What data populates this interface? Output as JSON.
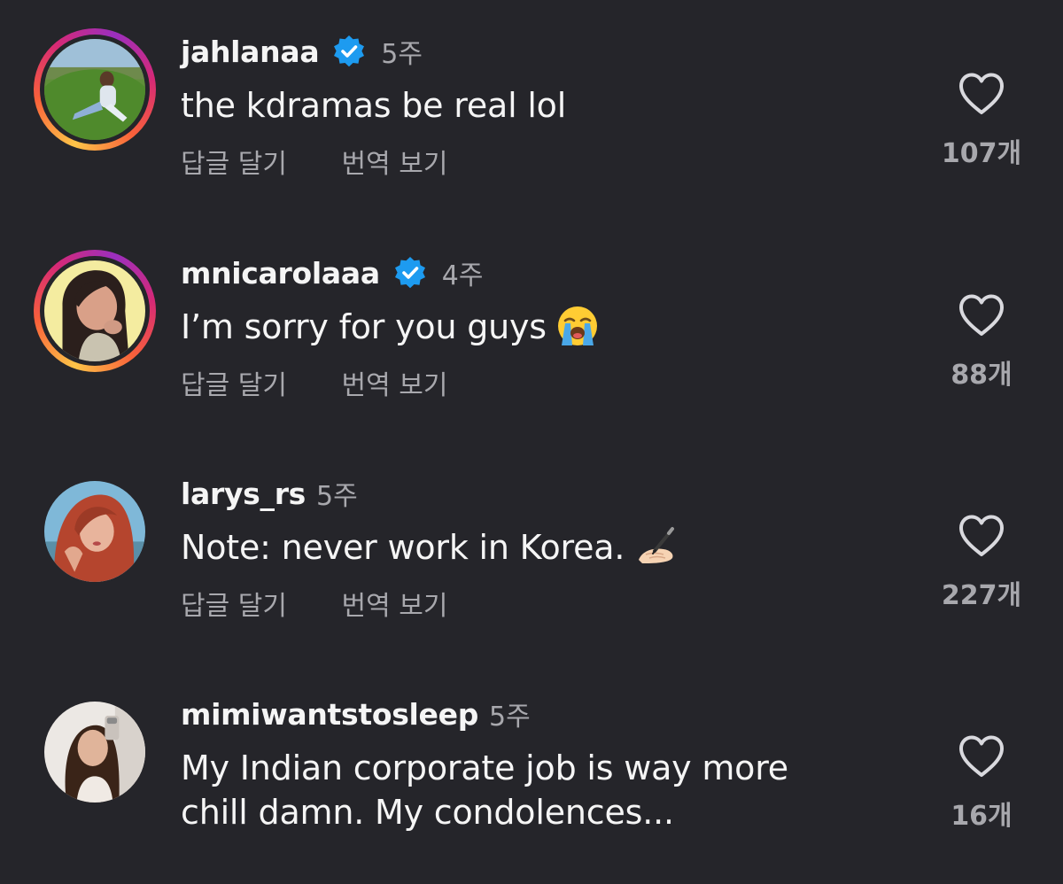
{
  "comments": [
    {
      "username": "jahlanaa",
      "verified": true,
      "time": "5주",
      "text": "the kdramas be real lol",
      "emoji": "",
      "reply_label": "답글 달기",
      "translate_label": "번역 보기",
      "likes": "107개",
      "avatar_ring": true
    },
    {
      "username": "mnicarolaaa",
      "verified": true,
      "time": "4주",
      "text": "I’m sorry for you guys",
      "emoji": "loudly-crying-face",
      "reply_label": "답글 달기",
      "translate_label": "번역 보기",
      "likes": "88개",
      "avatar_ring": true
    },
    {
      "username": "larys_rs",
      "verified": false,
      "time": "5주",
      "text": "Note: never work in Korea.",
      "emoji": "writing-hand",
      "reply_label": "답글 달기",
      "translate_label": "번역 보기",
      "likes": "227개",
      "avatar_ring": false
    },
    {
      "username": "mimiwantstosleep",
      "verified": false,
      "time": "5주",
      "text": "My Indian corporate job is way more chill damn. My condolences...",
      "emoji": "",
      "reply_label": "",
      "translate_label": "",
      "likes": "16개",
      "avatar_ring": false
    }
  ],
  "icons": {
    "like": "heart-outline-icon",
    "verified": "verified-badge-icon"
  },
  "colors": {
    "background": "#25252a",
    "verified": "#1d9bf0",
    "secondary_text": "#a8a8ad"
  }
}
